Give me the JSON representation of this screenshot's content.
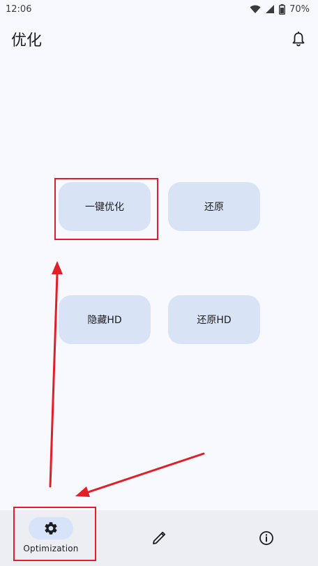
{
  "status_bar": {
    "time": "12:06",
    "battery": "70%",
    "icons": [
      "wifi-icon",
      "signal-icon",
      "battery-icon"
    ]
  },
  "app_bar": {
    "title": "优化",
    "action_icon": "bell-icon"
  },
  "actions": [
    {
      "label": "一键优化"
    },
    {
      "label": "还原"
    },
    {
      "label": "隐藏HD"
    },
    {
      "label": "还原HD"
    }
  ],
  "bottom_nav": {
    "items": [
      {
        "label": "Optimization",
        "icon": "gear-icon",
        "selected": true
      },
      {
        "label": "",
        "icon": "pencil-icon",
        "selected": false
      },
      {
        "label": "",
        "icon": "info-icon",
        "selected": false
      }
    ]
  },
  "annotations": {
    "color": "#e21e26"
  },
  "colors": {
    "background": "#f7f9ff",
    "button": "#d9e3f6",
    "nav_background": "#eceef4",
    "nav_pill": "#d6e3f8"
  }
}
